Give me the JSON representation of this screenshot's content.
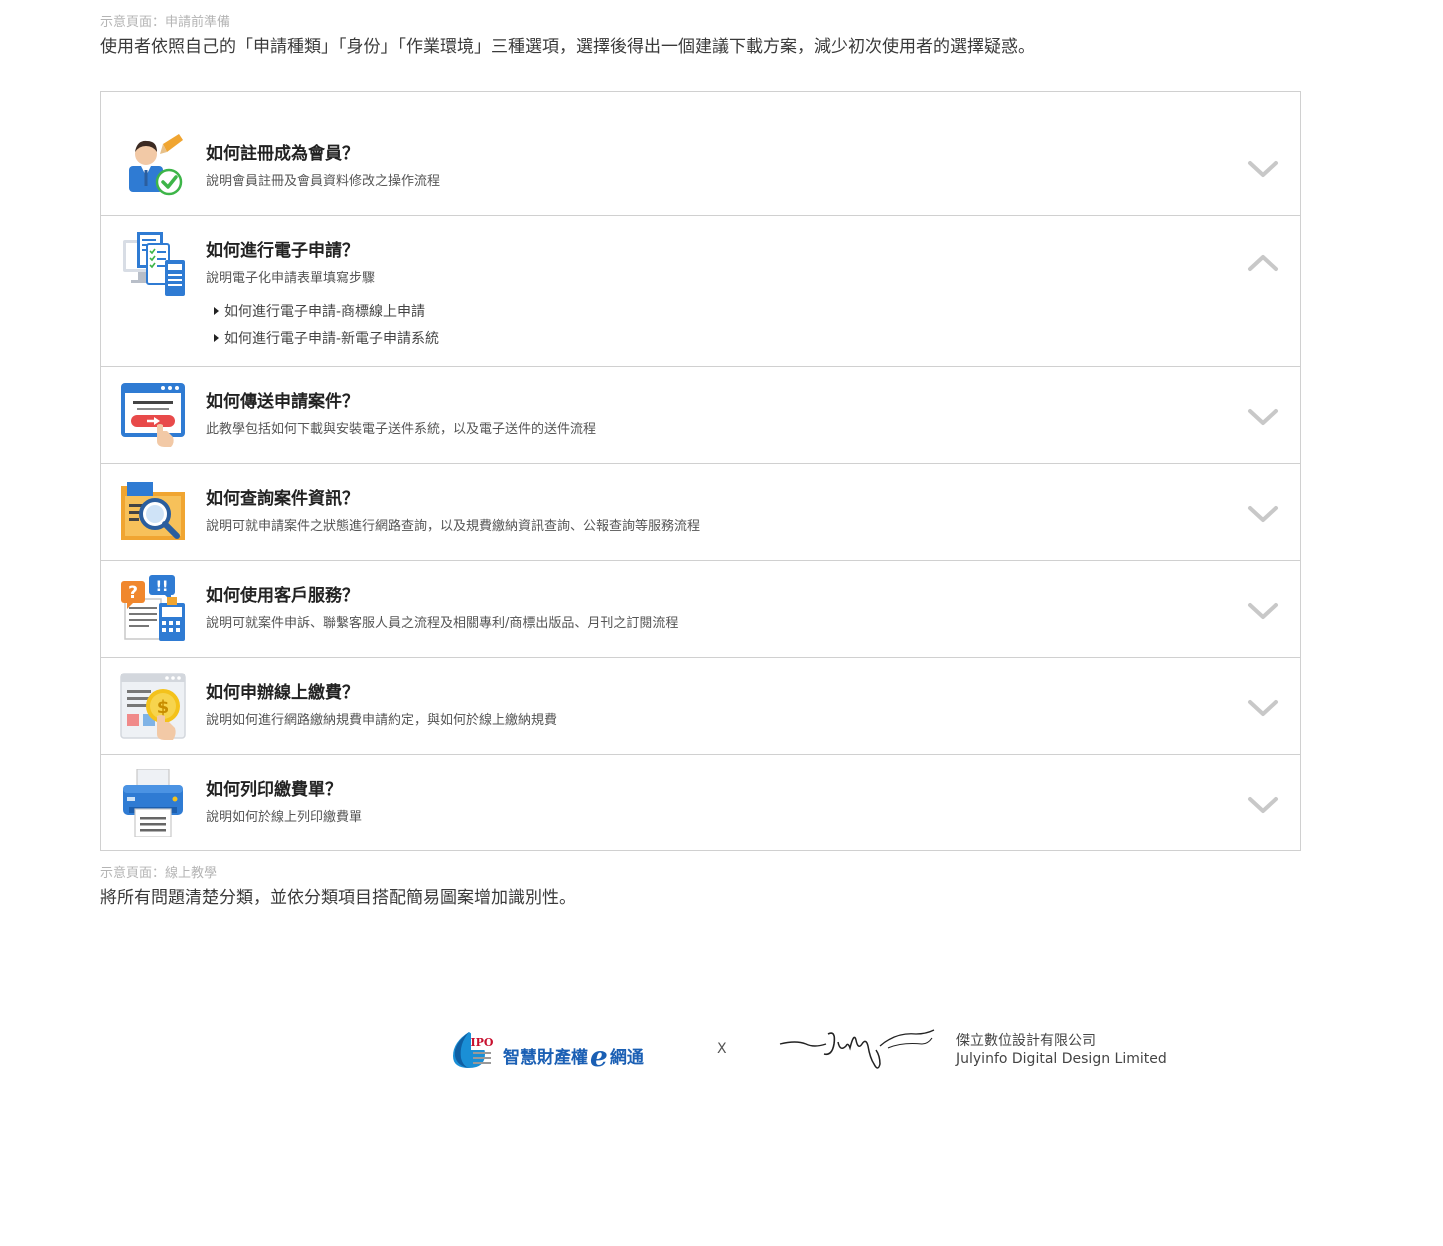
{
  "captions": {
    "top_label": "示意頁面：申請前準備",
    "top_description": "使用者依照自己的「申請種類」「身份」「作業環境」三種選項，選擇後得出一個建議下載方案，減少初次使用者的選擇疑惑。",
    "bottom_label": "示意頁面：線上教學",
    "bottom_description": "將所有問題清楚分類，並依分類項目搭配簡易圖案增加識別性。"
  },
  "faq": {
    "items": [
      {
        "title": "如何註冊成為會員？",
        "desc": "說明會員註冊及會員資料修改之操作流程",
        "icon": "member-register-icon",
        "expanded": false
      },
      {
        "title": "如何進行電子申請？",
        "desc": "說明電子化申請表單填寫步驟",
        "icon": "e-application-icon",
        "expanded": true,
        "links": [
          "如何進行電子申請-商標線上申請",
          "如何進行電子申請-新電子申請系統"
        ]
      },
      {
        "title": "如何傳送申請案件？",
        "desc": "此教學包括如何下載與安裝電子送件系統，以及電子送件的送件流程",
        "icon": "send-case-icon",
        "expanded": false
      },
      {
        "title": "如何查詢案件資訊？",
        "desc": "說明可就申請案件之狀態進行網路查詢，以及規費繳納資訊查詢、公報查詢等服務流程",
        "icon": "search-case-icon",
        "expanded": false
      },
      {
        "title": "如何使用客戶服務？",
        "desc": "說明可就案件申訴、聯繫客服人員之流程及相關專利/商標出版品、月刊之訂閱流程",
        "icon": "customer-service-icon",
        "expanded": false
      },
      {
        "title": "如何申辦線上繳費？",
        "desc": "說明如何進行網路繳納規費申請約定，與如何於線上繳納規費",
        "icon": "online-payment-icon",
        "expanded": false
      },
      {
        "title": "如何列印繳費單？",
        "desc": "說明如何於線上列印繳費單",
        "icon": "printer-icon",
        "expanded": false
      }
    ]
  },
  "footer": {
    "ipo_name": "智慧財產權",
    "ipo_e": "e",
    "ipo_suffix": "網通",
    "x": "X",
    "company_cn": "傑立數位設計有限公司",
    "company_en": "Julyinfo Digital Design Limited"
  },
  "colors": {
    "border": "#d0d0d0",
    "chevron": "#c8c8c8",
    "brand_blue": "#1a5fb4"
  }
}
